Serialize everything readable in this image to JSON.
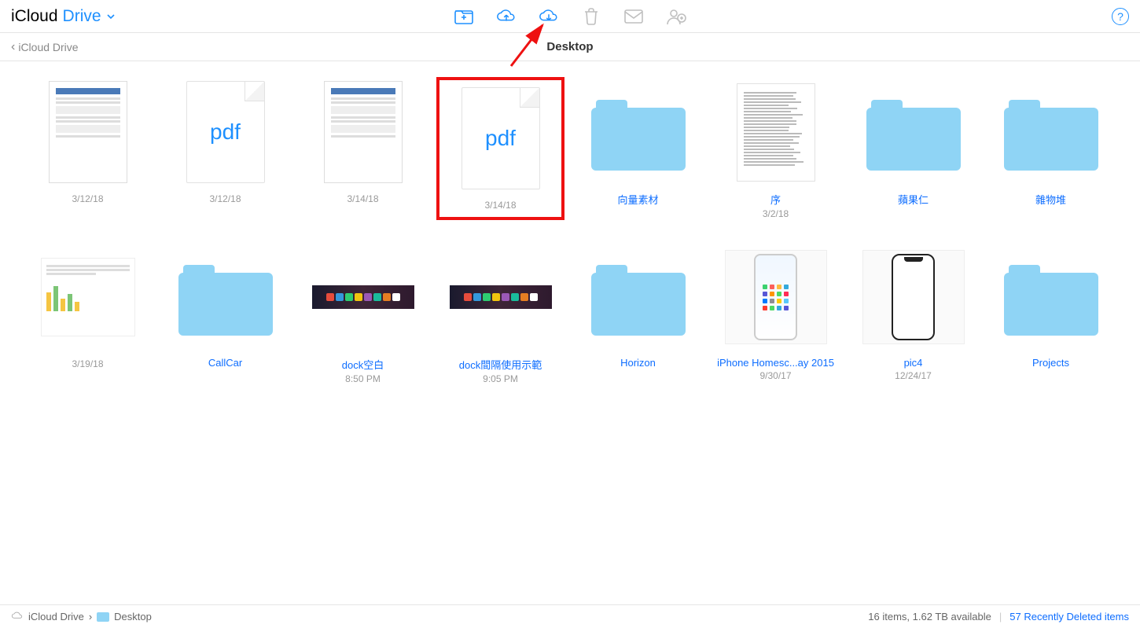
{
  "brand": {
    "part1": "iCloud",
    "part2": "Drive"
  },
  "toolbar": {
    "new_folder": "new-folder",
    "upload": "upload",
    "download": "download",
    "delete": "delete",
    "email": "email",
    "share": "share",
    "help": "?"
  },
  "nav": {
    "back": "iCloud Drive",
    "title": "Desktop"
  },
  "items": [
    {
      "name": " ",
      "date": "3/12/18",
      "type": "doc",
      "blurred": true
    },
    {
      "name": " ",
      "date": "3/12/18",
      "type": "pdf",
      "blurred": true
    },
    {
      "name": " ",
      "date": "3/14/18",
      "type": "doc",
      "blurred": true
    },
    {
      "name": " ",
      "date": "3/14/18",
      "type": "pdf",
      "blurred": true,
      "highlight": true
    },
    {
      "name": "向量素材",
      "date": "",
      "type": "folder"
    },
    {
      "name": "序",
      "date": "3/2/18",
      "type": "textdoc"
    },
    {
      "name": "蘋果仁",
      "date": "",
      "type": "folder"
    },
    {
      "name": "雜物堆",
      "date": "",
      "type": "folder"
    },
    {
      "name": " ",
      "date": "3/19/18",
      "type": "chart",
      "blurred": true
    },
    {
      "name": "CallCar",
      "date": "",
      "type": "folder"
    },
    {
      "name": "dock空白",
      "date": "8:50 PM",
      "type": "dockimg"
    },
    {
      "name": "dock間隔使用示範",
      "date": "9:05 PM",
      "type": "dockimg"
    },
    {
      "name": "Horizon",
      "date": "",
      "type": "folder"
    },
    {
      "name": "iPhone Homesc...ay 2015",
      "date": "9/30/17",
      "type": "phone-color"
    },
    {
      "name": "pic4",
      "date": "12/24/17",
      "type": "phone-outline"
    },
    {
      "name": "Projects",
      "date": "",
      "type": "folder"
    }
  ],
  "status": {
    "root": "iCloud Drive",
    "current": "Desktop",
    "summary": "16 items, 1.62 TB available",
    "deleted": "57 Recently Deleted items"
  },
  "pdf_label": "pdf"
}
